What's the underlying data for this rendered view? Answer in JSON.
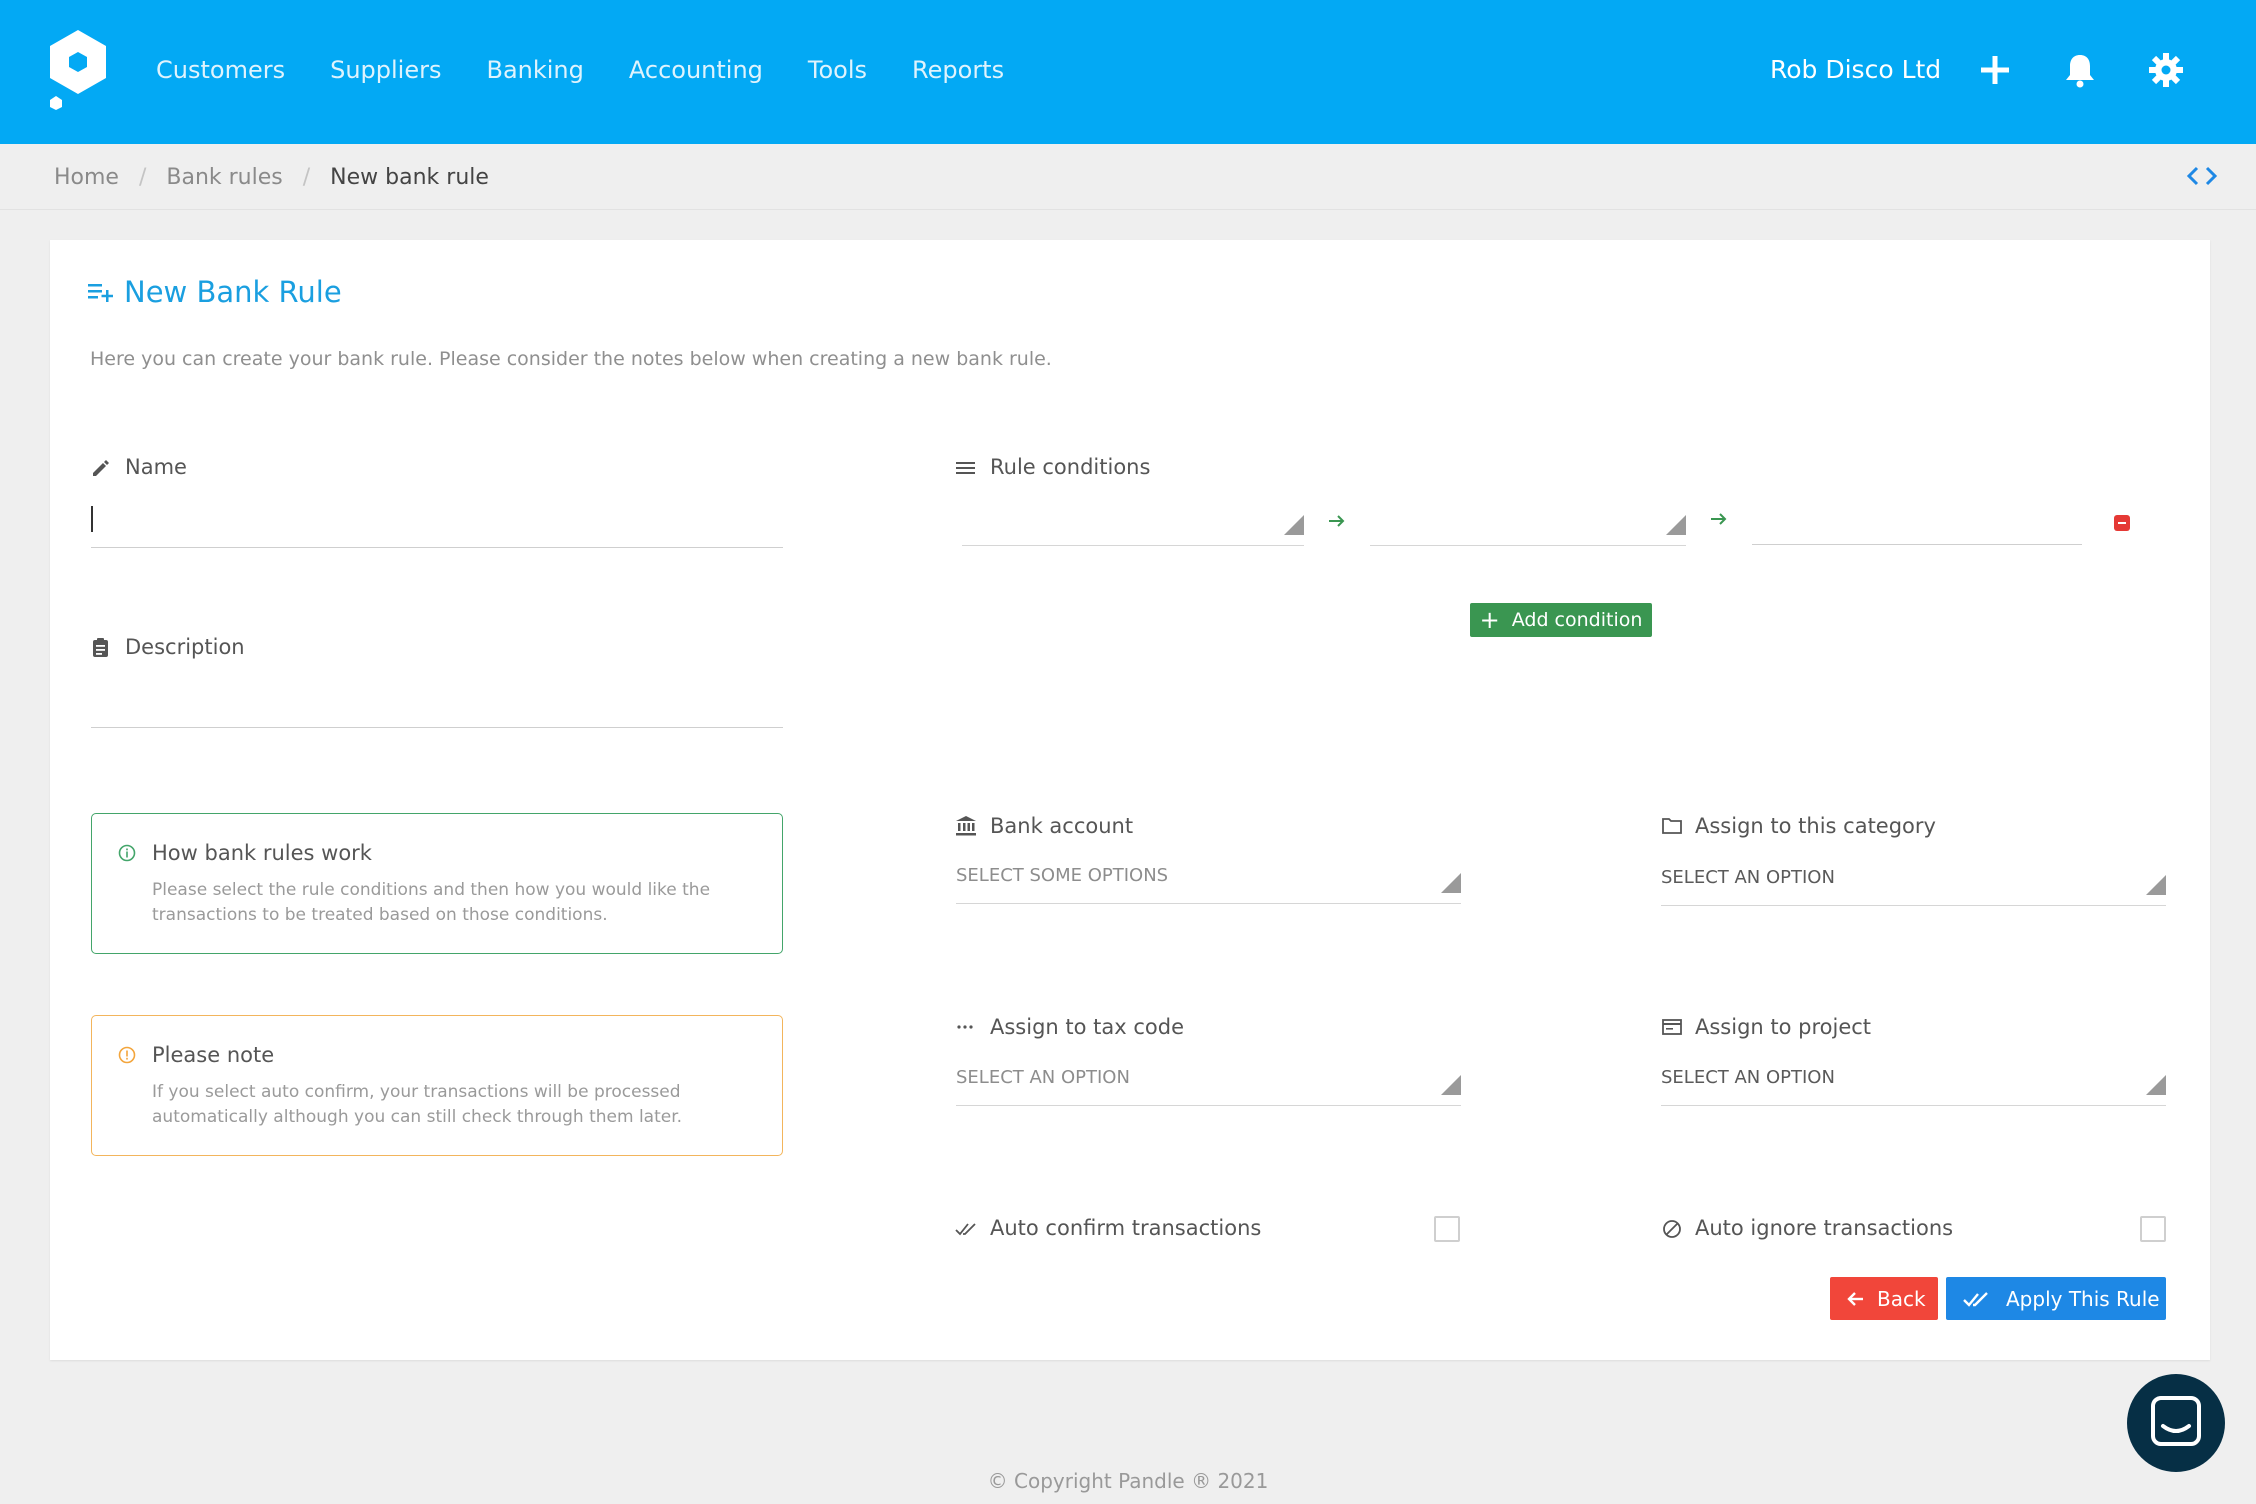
{
  "header": {
    "nav": [
      "Customers",
      "Suppliers",
      "Banking",
      "Accounting",
      "Tools",
      "Reports"
    ],
    "company": "Rob Disco Ltd",
    "icons": [
      "plus-icon",
      "bell-icon",
      "gear-icon"
    ],
    "color": "#03a9f4"
  },
  "breadcrumb": {
    "items": [
      "Home",
      "Bank rules",
      "New bank rule"
    ]
  },
  "card": {
    "title": "New Bank Rule",
    "description": "Here you can create your bank rule. Please consider the notes below when creating a new bank rule."
  },
  "form": {
    "name_label": "Name",
    "name_value": "",
    "description_label": "Description",
    "description_value": "",
    "rule_conditions_label": "Rule conditions",
    "add_condition_label": "Add condition",
    "bank_account_label": "Bank account",
    "bank_account_placeholder": "SELECT SOME OPTIONS",
    "category_label": "Assign to this category",
    "category_placeholder": "SELECT AN OPTION",
    "tax_code_label": "Assign to tax code",
    "tax_code_placeholder": "SELECT AN OPTION",
    "project_label": "Assign to project",
    "project_placeholder": "SELECT AN OPTION",
    "auto_confirm_label": "Auto confirm transactions",
    "auto_confirm_checked": false,
    "auto_ignore_label": "Auto ignore transactions",
    "auto_ignore_checked": false
  },
  "notes": {
    "how_title": "How bank rules work",
    "how_text": "Please select the rule conditions and then how you would like the transactions to be treated based on those conditions.",
    "note_title": "Please note",
    "note_text": "If you select auto confirm, your transactions will be processed automatically although you can still check through them later."
  },
  "buttons": {
    "back": "Back",
    "apply": "Apply This Rule"
  },
  "footer": "© Copyright Pandle ® 2021",
  "colors": {
    "accent": "#1a9fe0",
    "add": "#3a9651",
    "back": "#f1463a",
    "apply": "#1e88e5",
    "info_green": "#43a56a",
    "info_orange": "#f3b55c"
  }
}
